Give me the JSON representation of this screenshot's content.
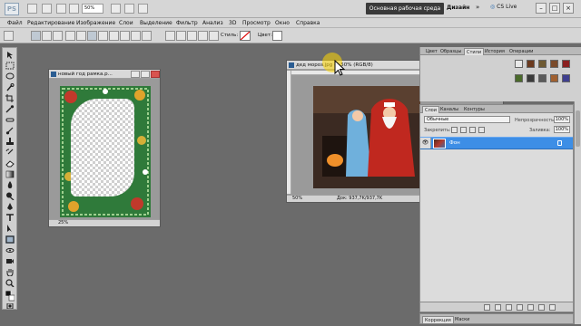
{
  "app": {
    "logo": "PS",
    "zoom": "50%",
    "workspace_button": "Основная рабочая среда",
    "design_label": "Дизайн",
    "cslive": "CS Live",
    "controls": [
      "–",
      "□",
      "×"
    ]
  },
  "menu": {
    "items": [
      "Файл",
      "Редактирование",
      "Изображение",
      "Слои",
      "Выделение",
      "Фильтр",
      "Анализ",
      "3D",
      "Просмотр",
      "Окно",
      "Справка"
    ]
  },
  "options": {
    "style_label": "Стиль:",
    "color_label": "Цвет:"
  },
  "doc1": {
    "title": "новый год рамка.p...",
    "zoom": "25%"
  },
  "doc2": {
    "title": "дед мороз.jpg @ 50% (RGB/8)",
    "zoom": "50%",
    "info": "Док: 937,7K/937,7K"
  },
  "panels": {
    "top_tabs": [
      "Цвет",
      "Образцы",
      "Стили",
      "История",
      "Операции"
    ],
    "active_top_tab": "Стили",
    "style_colors": [
      "#e9e9e9",
      "#6b3a1f",
      "#6e5a32",
      "#7a4a2a",
      "#8a1f1f",
      "#4a6a2a",
      "#3a3a3a",
      "#5a5a5a",
      "#a06030",
      "#3f3f8f",
      "#444",
      "#2a2a2a"
    ],
    "layers_tabs": [
      "Слои",
      "Каналы",
      "Контуры"
    ],
    "blend_mode": "Обычные",
    "opacity_label": "Непрозрачность:",
    "opacity": "100%",
    "lock_label": "Закрепить:",
    "fill_label": "Заливка:",
    "fill": "100%",
    "layer_name": "Фон",
    "bottom_tabs": [
      "Коррекция",
      "Маски"
    ]
  }
}
